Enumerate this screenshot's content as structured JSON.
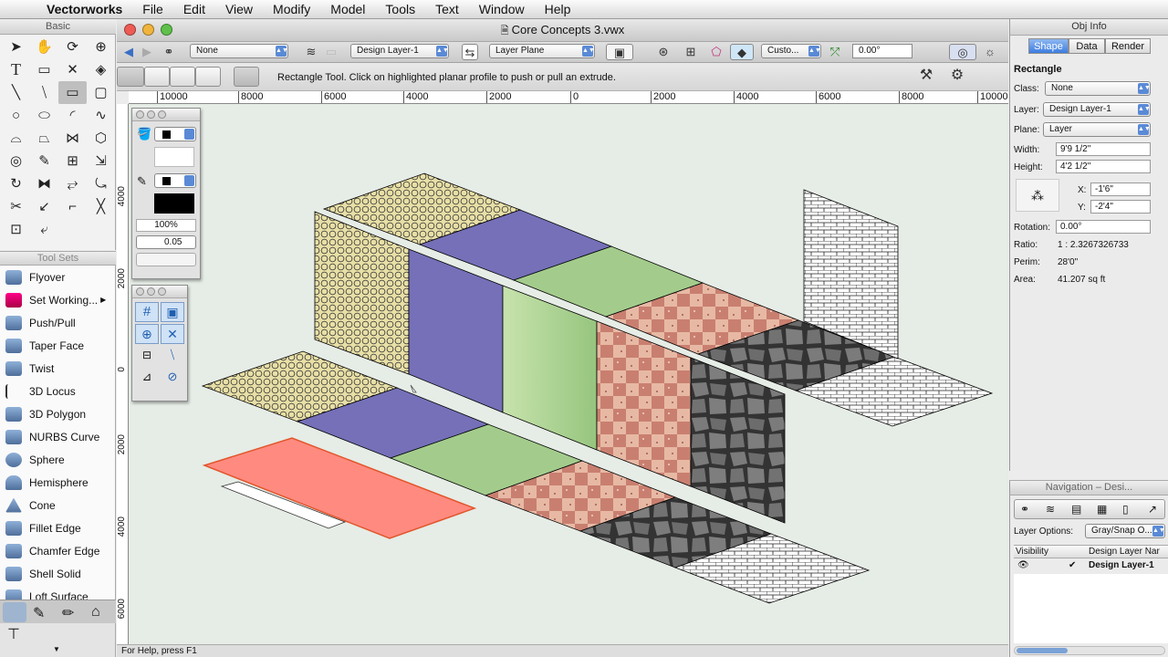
{
  "menubar": {
    "app": "Vectorworks",
    "items": [
      "File",
      "Edit",
      "View",
      "Modify",
      "Model",
      "Tools",
      "Text",
      "Window",
      "Help"
    ]
  },
  "window": {
    "title": "Core Concepts 3.vwx"
  },
  "viewbar": {
    "class_popup": "None",
    "layer_popup": "Design Layer-1",
    "plane_popup": "Layer Plane",
    "view_popup": "Custo...",
    "rotation": "0.00°"
  },
  "modebar": {
    "help": "Rectangle Tool. Click on highlighted planar profile to push or pull an extrude."
  },
  "ruler_top": [
    "10000",
    "8000",
    "6000",
    "4000",
    "2000",
    "0",
    "2000",
    "4000",
    "6000",
    "8000",
    "10000"
  ],
  "ruler_left": [
    "4000",
    "2000",
    "0",
    "2000",
    "4000",
    "6000"
  ],
  "basic_palette": {
    "title": "Basic"
  },
  "toolsets": {
    "title": "Tool Sets",
    "items": [
      "Flyover",
      "Set Working...",
      "Push/Pull",
      "Taper Face",
      "Twist",
      "3D Locus",
      "3D Polygon",
      "NURBS Curve",
      "Sphere",
      "Hemisphere",
      "Cone",
      "Fillet Edge",
      "Chamfer Edge",
      "Shell Solid",
      "Loft Surface"
    ]
  },
  "attributes": {
    "opacity": "100%",
    "line_weight": "0.05"
  },
  "obj_info": {
    "title": "Obj Info",
    "tabs": [
      "Shape",
      "Data",
      "Render"
    ],
    "object_type": "Rectangle",
    "class_label": "Class:",
    "class_value": "None",
    "layer_label": "Layer:",
    "layer_value": "Design Layer-1",
    "plane_label": "Plane:",
    "plane_value": "Layer",
    "width_label": "Width:",
    "width_value": "9'9 1/2\"",
    "height_label": "Height:",
    "height_value": "4'2 1/2\"",
    "x_label": "X:",
    "x_value": "-1'6\"",
    "y_label": "Y:",
    "y_value": "-2'4\"",
    "rotation_label": "Rotation:",
    "rotation_value": "0.00°",
    "ratio_label": "Ratio:",
    "ratio_value": "1 : 2.3267326733",
    "perim_label": "Perim:",
    "perim_value": "28'0\"",
    "area_label": "Area:",
    "area_value": "41.207 sq ft"
  },
  "navigation": {
    "title": "Navigation – Desi...",
    "layer_options_label": "Layer Options:",
    "layer_options_value": "Gray/Snap O...",
    "col_visibility": "Visibility",
    "col_name": "Design Layer Nar",
    "row_name": "Design Layer-1"
  },
  "status": {
    "text": "For Help, press F1"
  },
  "colors": {
    "selection_blue": "#3d7de0",
    "purple": "#7570b8",
    "green": "#a3cc8c",
    "pink_rect": "#ff8a80"
  }
}
